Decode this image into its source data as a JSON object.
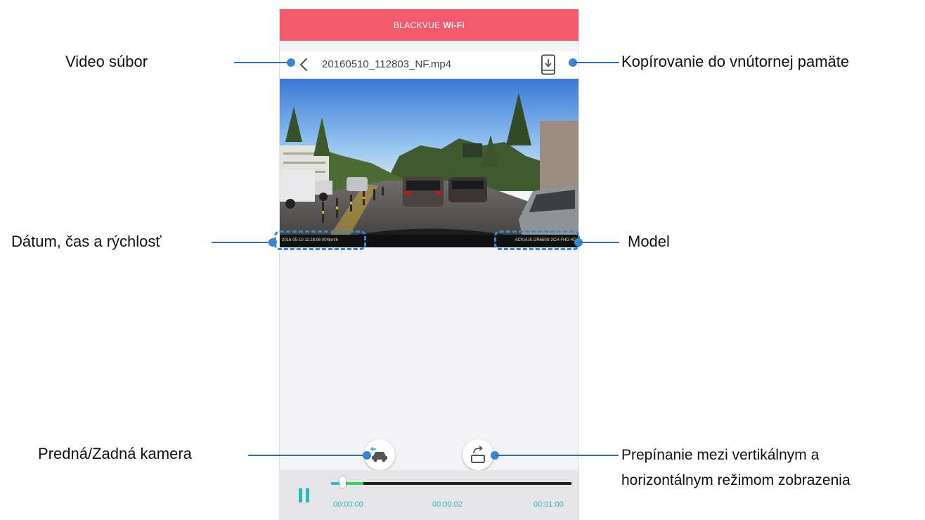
{
  "app": {
    "title_regular": "BLACKVUE",
    "title_bold": "Wi-Fi",
    "accent_color": "#f45a6d"
  },
  "file_bar": {
    "file_name": "20160510_112803_NF.mp4",
    "back_icon": "chevron-left-icon",
    "download_icon": "phone-download-icon"
  },
  "video": {
    "overlay_left": "2016-05-10  11:28:06    004km/h",
    "overlay_right": "ACKVUE  DR650S-2CH FHD HD"
  },
  "controls": {
    "camera_icon": "car-front-rear-camera-icon",
    "rotate_icon": "rotate-screen-icon"
  },
  "player": {
    "time_start": "00:00:00",
    "time_mid": "00:00:02",
    "time_end": "00:01:00",
    "progress_fraction": 0.03,
    "accent_color": "#2bb5c4"
  },
  "annotations": {
    "video_file": "Video súbor",
    "copy_internal": "Kopírovanie do vnútornej pamäte",
    "date_time_speed": "Dátum, čas a rýchlosť",
    "model": "Model",
    "front_rear": "Predná/Zadná kamera",
    "orientation_line1": "Prepínanie mezi vertikálnym a",
    "orientation_line2": "horizontálnym režimom zobrazenia"
  }
}
